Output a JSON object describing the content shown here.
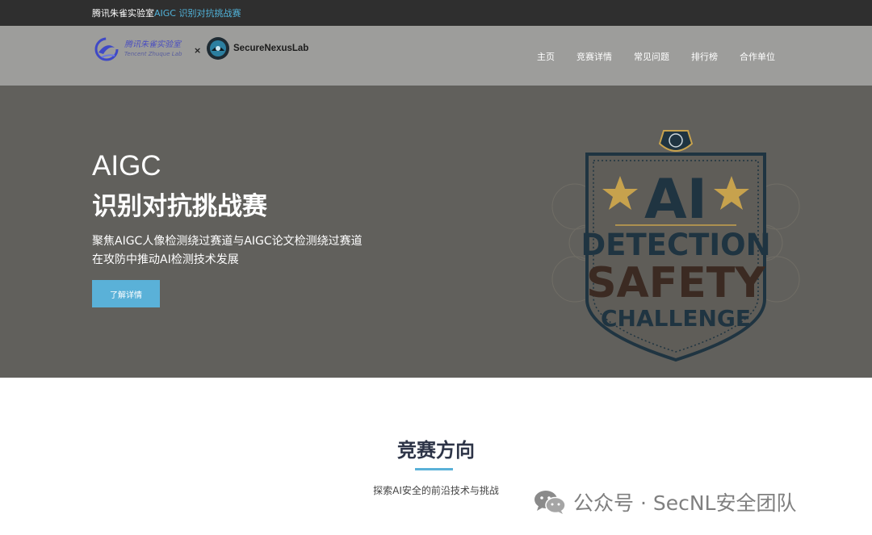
{
  "topbar": {
    "site_name": "腾讯朱雀实验室",
    "event_name": "AIGC 识别对抗挑战赛"
  },
  "logos": {
    "tencent_cn": "腾讯朱雀实验室",
    "tencent_en": "Tencent Zhuque Lab",
    "times": "×",
    "partner": "SecureNexusLab"
  },
  "nav": {
    "items": [
      "主页",
      "竞赛详情",
      "常见问题",
      "排行榜",
      "合作单位"
    ]
  },
  "hero": {
    "title_line1": "AIGC",
    "title_line2": "识别对抗挑战赛",
    "desc_line1": "聚焦AIGC人像检测绕过赛道与AIGC论文检测绕过赛道",
    "desc_line2": "在攻防中推动AI检测技术发展",
    "cta_label": "了解详情",
    "badge": {
      "line1": "AI",
      "line2": "DETECTION",
      "line3": "SAFETY",
      "line4": "CHALLENGE"
    }
  },
  "section": {
    "title": "竞赛方向",
    "subtitle": "探索AI安全的前沿技术与挑战"
  },
  "watermark": {
    "text": "公众号 · SecNL安全团队",
    "icon": "wechat-icon"
  },
  "colors": {
    "accent": "#5ab1d8",
    "topbar": "#2f2f2f",
    "navbar": "#9d9d9b",
    "hero": "#61605c",
    "badge_navy": "#1f3441",
    "badge_gold": "#c7a24d"
  }
}
